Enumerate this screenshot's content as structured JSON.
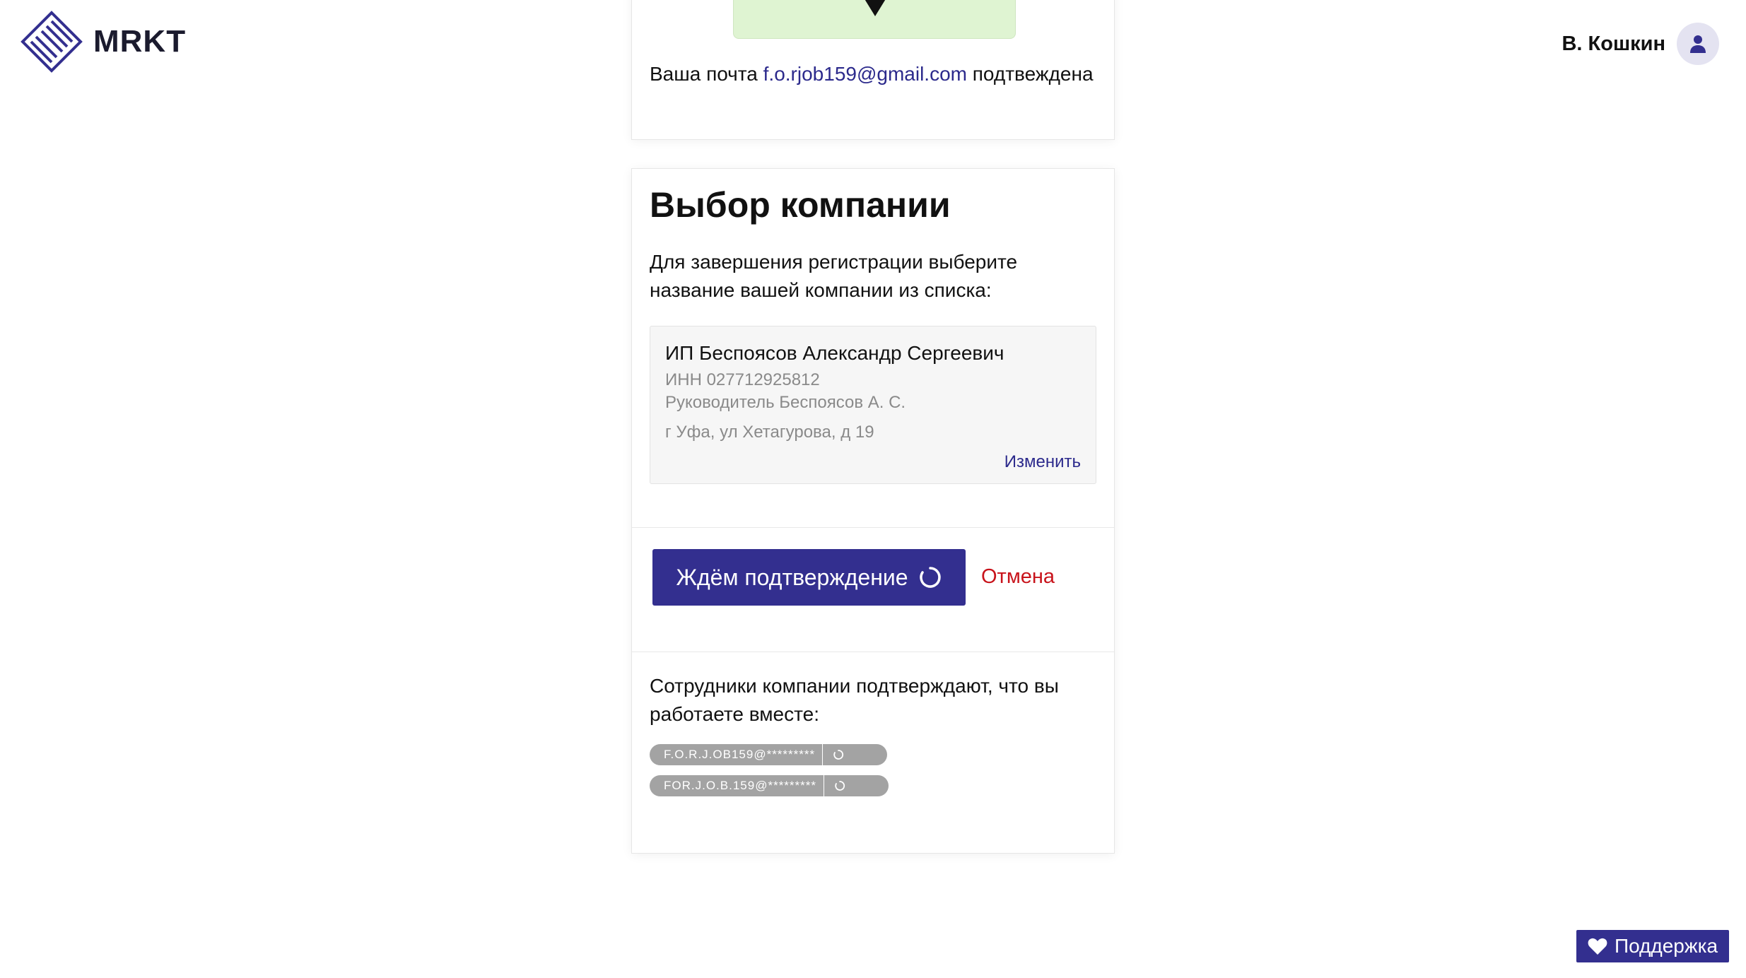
{
  "header": {
    "logo_text": "MRKT",
    "user_name": "В. Кошкин"
  },
  "email_card": {
    "prefix": "Ваша почта",
    "email": "f.o.rjob159@gmail.com",
    "suffix": "подтвеждена"
  },
  "company_card": {
    "title": "Выбор компании",
    "description": "Для завершения регистрации выберите название вашей компании из списка:",
    "company": {
      "name": "ИП Беспоясов Александр Сергеевич",
      "inn": "ИНН 027712925812",
      "head": "Руководитель Беспоясов А. С.",
      "address": "г Уфа, ул Хетагурова, д 19",
      "change_label": "Изменить"
    },
    "wait_button_label": "Ждём подтверждение",
    "cancel_label": "Отмена",
    "confirm_text": "Сотрудники компании подтверждают, что вы работаете вместе:",
    "colleagues": [
      {
        "email": "F.O.R.J.OB159@*********"
      },
      {
        "email": "FOR.J.O.B.159@*********"
      }
    ]
  },
  "support": {
    "label": "Поддержка"
  },
  "colors": {
    "brand": "#332f8f",
    "link": "#2c2a8c",
    "danger": "#c8131b",
    "success_bg": "#dff4d2"
  }
}
